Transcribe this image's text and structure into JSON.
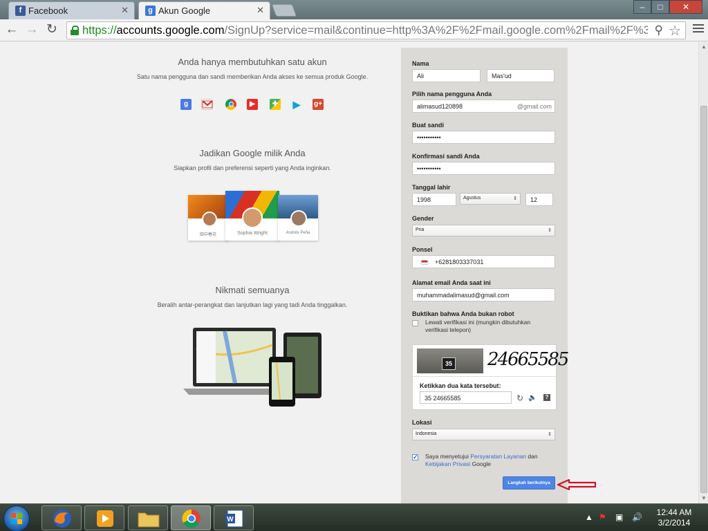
{
  "browser": {
    "tabs": [
      {
        "label": "Facebook",
        "favicon": "f"
      },
      {
        "label": "Akun Google",
        "favicon": "g"
      }
    ],
    "url": {
      "scheme": "https://",
      "host": "accounts.google.com",
      "path": "/SignUp?service=mail&continue=http%3A%2F%2Fmail.google.com%2Fmail%2F%3Fpc%3"
    },
    "window_controls": {
      "minimize": "–",
      "maximize": "□",
      "close": "✕"
    }
  },
  "left": {
    "section1": {
      "heading": "Anda hanya membutuhkan satu akun",
      "text": "Satu nama pengguna dan sandi memberikan Anda akses ke semua produk Google."
    },
    "product_icons": [
      "google-search-icon",
      "gmail-icon",
      "chrome-icon",
      "youtube-icon",
      "maps-icon",
      "play-icon",
      "google-plus-icon"
    ],
    "section2": {
      "heading": "Jadikan Google milik Anda",
      "text": "Siapkan profil dan preferensi seperti yang Anda inginkan."
    },
    "profiles": [
      "田中春花",
      "Sophia Wright",
      "Andrés Peña"
    ],
    "section3": {
      "heading": "Nikmati semuanya",
      "text": "Beralih antar-perangkat dan lanjutkan lagi yang tadi Anda tinggalkan."
    }
  },
  "form": {
    "name_label": "Nama",
    "first_name": "Ali",
    "last_name": "Mas'ud",
    "username_label": "Pilih nama pengguna Anda",
    "username": "alimasud120898",
    "username_suffix": "@gmail.com",
    "password_label": "Buat sandi",
    "password": "•••••••••••",
    "confirm_label": "Konfirmasi sandi Anda",
    "confirm": "•••••••••••",
    "birthday_label": "Tanggal lahir",
    "birth_year": "1998",
    "birth_month": "Agustus",
    "birth_day": "12",
    "gender_label": "Gender",
    "gender": "Pria",
    "phone_label": "Ponsel",
    "phone": "+6281803337031",
    "email_label": "Alamat email Anda saat ini",
    "email": "muhammadalimasud@gmail.com",
    "robot_label": "Buktikan bahwa Anda bukan robot",
    "skip_verification": "Lewati verifikasi ini (mungkin dibutuhkan verifikasi telepon)",
    "captcha_number_sign": "35",
    "captcha_word": "24665585",
    "captcha_prompt": "Ketikkan dua kata tersebut:",
    "captcha_answer": "35 24665585",
    "location_label": "Lokasi",
    "location": "Indonesia",
    "agree_prefix": "Saya menyetujui",
    "terms_link": "Persyaratan Layanan",
    "agree_and": "dan",
    "privacy_link": "Kebijakan Privasi",
    "agree_suffix": "Google",
    "submit": "Langkah berikutnya"
  },
  "taskbar": {
    "time": "12:44 AM",
    "date": "3/2/2014"
  },
  "colors": {
    "accent": "#4d86e6",
    "annotation_arrow": "#d0102a",
    "https_green": "#1e8a1e"
  }
}
